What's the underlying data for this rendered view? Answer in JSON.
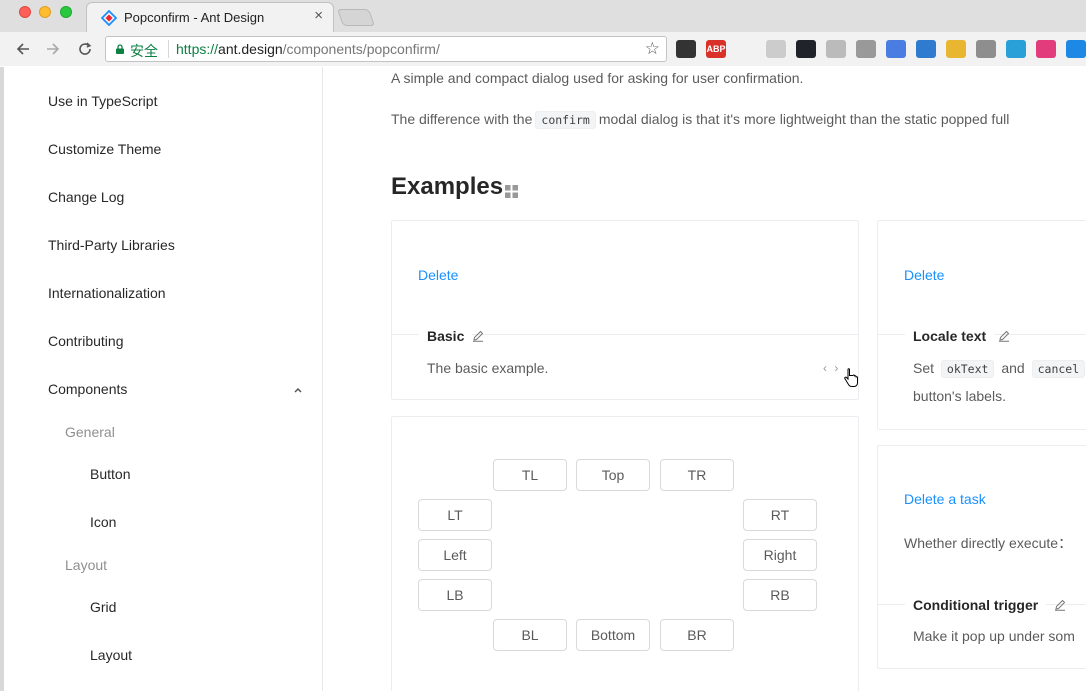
{
  "browser": {
    "tab_title": "Popconfirm - Ant Design",
    "tab_close": "×",
    "secure_label": "安全",
    "url_proto": "https://",
    "url_host": "ant.design",
    "url_path": "/components/popconfirm/",
    "star_glyph": "☆",
    "extensions": [
      {
        "name": "ghostery-icon",
        "color": "#333333",
        "text": ""
      },
      {
        "name": "adblock-plus-icon",
        "color": "#d9312a",
        "text": "ABP"
      },
      {
        "name": "move-tool-icon",
        "color": "#f2f2f2",
        "text": ""
      },
      {
        "name": "circle-extension-icon",
        "color": "#cccccc",
        "text": ""
      },
      {
        "name": "react-devtools-icon",
        "color": "#20232a",
        "text": ""
      },
      {
        "name": "page-extension-icon",
        "color": "#bbbbbb",
        "text": ""
      },
      {
        "name": "tag-extension-icon",
        "color": "#999999",
        "text": ""
      },
      {
        "name": "vectr-icon",
        "color": "#4a7de2",
        "text": ""
      },
      {
        "name": "sync-extension-icon",
        "color": "#2e7bcf",
        "text": ""
      },
      {
        "name": "color-palette-icon",
        "color": "#e8b631",
        "text": ""
      },
      {
        "name": "s-extension-icon",
        "color": "#8e8e8e",
        "text": ""
      },
      {
        "name": "calendar-extension-icon",
        "color": "#2aa0d8",
        "text": ""
      },
      {
        "name": "color-wheel-icon",
        "color": "#e23c7d",
        "text": ""
      },
      {
        "name": "eye-extension-icon",
        "color": "#1e88e5",
        "text": ""
      }
    ]
  },
  "sidebar": {
    "items": [
      {
        "label": "Use in TypeScript"
      },
      {
        "label": "Customize Theme"
      },
      {
        "label": "Change Log"
      },
      {
        "label": "Third-Party Libraries"
      },
      {
        "label": "Internationalization"
      },
      {
        "label": "Contributing"
      },
      {
        "label": "Components"
      }
    ],
    "groups": [
      {
        "label": "General",
        "items": [
          "Button",
          "Icon"
        ]
      },
      {
        "label": "Layout",
        "items": [
          "Grid",
          "Layout"
        ]
      }
    ]
  },
  "main": {
    "intro": "A simple and compact dialog used for asking for user confirmation.",
    "intro2_before": "The difference with the",
    "intro2_code": "confirm",
    "intro2_after": "modal dialog is that it's more lightweight than the static popped full",
    "examples_title": "Examples",
    "basic": {
      "action": "Delete",
      "title": "Basic",
      "desc": "The basic example.",
      "code_toggle": "‹ ›"
    },
    "locale": {
      "action": "Delete",
      "title": "Locale text",
      "desc_set": "Set",
      "desc_code1": "okText",
      "desc_and": "and",
      "desc_code2": "cancel",
      "desc_line2": "button's labels."
    },
    "placement": {
      "buttons": {
        "tl": "TL",
        "top": "Top",
        "tr": "TR",
        "lt": "LT",
        "left": "Left",
        "lb": "LB",
        "rt": "RT",
        "right": "Right",
        "rb": "RB",
        "bl": "BL",
        "bottom": "Bottom",
        "br": "BR"
      }
    },
    "conditional": {
      "action": "Delete a task",
      "desc_top": "Whether directly execute：",
      "title": "Conditional trigger",
      "desc": "Make it pop up under som"
    }
  }
}
